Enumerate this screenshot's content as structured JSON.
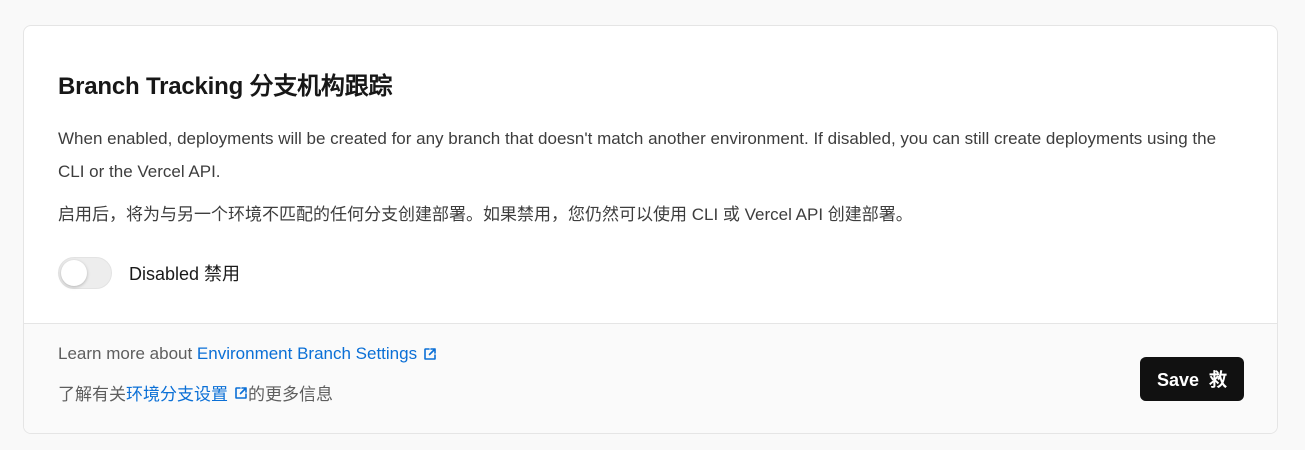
{
  "section": {
    "title": "Branch Tracking  分支机构跟踪",
    "description_en": "When enabled, deployments will be created for any branch that doesn't match another environment. If disabled, you can still create deployments using the CLI or the Vercel API.",
    "description_zh": "启用后，将为与另一个环境不匹配的任何分支创建部署。如果禁用，您仍然可以使用 CLI 或 Vercel API 创建部署。",
    "toggle": {
      "state": "off",
      "label": "Disabled  禁用"
    }
  },
  "footer": {
    "learn_prefix_en": "Learn more about ",
    "learn_link_en": "Environment Branch Settings",
    "learn_prefix_zh": "了解有关",
    "learn_link_zh": "环境分支设置",
    "learn_suffix_zh": "的更多信息",
    "save_label": "Save  救"
  },
  "icons": {
    "external_link": "external-link-icon"
  },
  "colors": {
    "link": "#0a6fd6",
    "button_bg": "#111111",
    "card_bg": "#ffffff",
    "footer_bg": "#fafafa",
    "toggle_off": "#ededed"
  }
}
